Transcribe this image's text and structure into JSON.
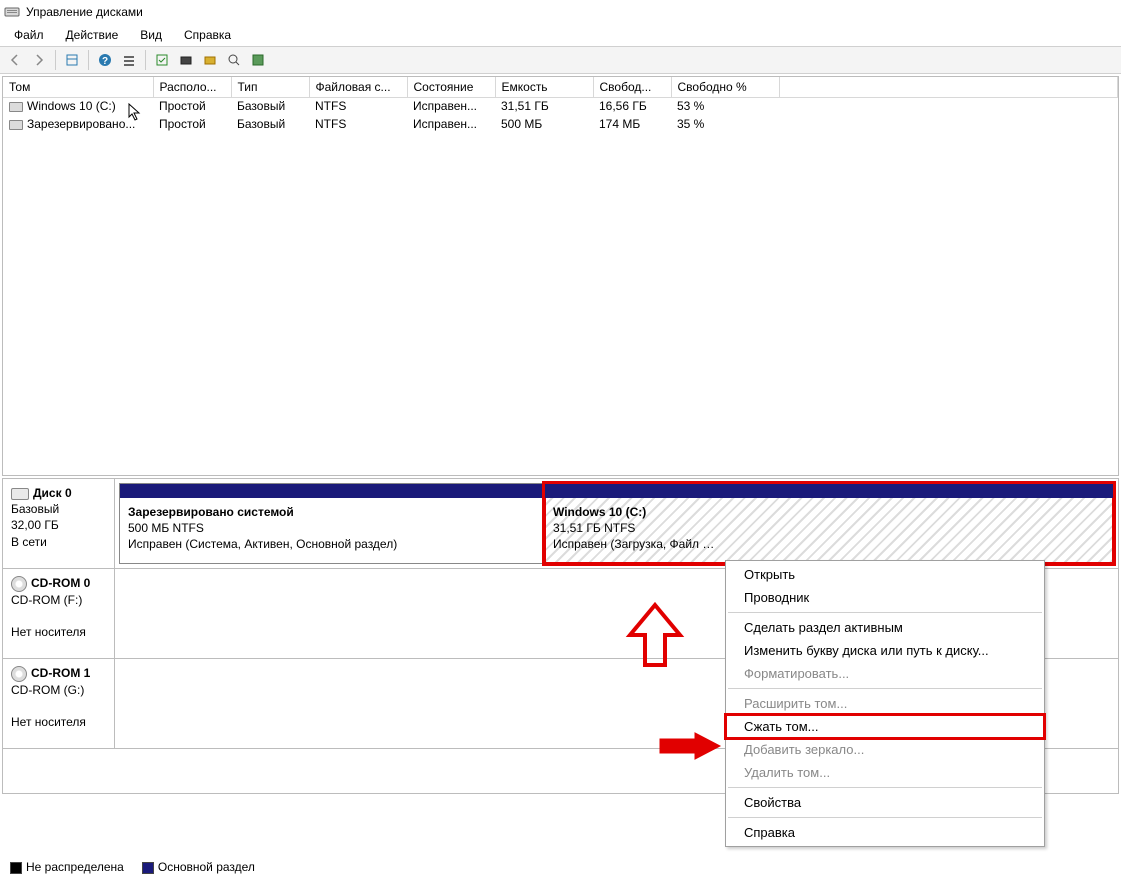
{
  "title": "Управление дисками",
  "menu": {
    "file": "Файл",
    "action": "Действие",
    "view": "Вид",
    "help": "Справка"
  },
  "columns": [
    "Том",
    "Располо...",
    "Тип",
    "Файловая с...",
    "Состояние",
    "Емкость",
    "Свобод...",
    "Свободно %"
  ],
  "rows": [
    {
      "vol": "Windows 10 (C:)",
      "layout": "Простой",
      "type": "Базовый",
      "fs": "NTFS",
      "status": "Исправен...",
      "cap": "31,51 ГБ",
      "free": "16,56 ГБ",
      "pct": "53 %"
    },
    {
      "vol": "Зарезервировано...",
      "layout": "Простой",
      "type": "Базовый",
      "fs": "NTFS",
      "status": "Исправен...",
      "cap": "500 МБ",
      "free": "174 МБ",
      "pct": "35 %"
    }
  ],
  "disks": {
    "d0": {
      "name": "Диск 0",
      "type": "Базовый",
      "size": "32,00 ГБ",
      "status": "В сети",
      "p1": {
        "title": "Зарезервировано системой",
        "sub": "500 МБ NTFS",
        "stat": "Исправен (Система, Активен, Основной раздел)"
      },
      "p2": {
        "title": "Windows 10  (C:)",
        "sub": "31,51 ГБ NTFS",
        "stat": "Исправен (Загрузка, Файл"
      }
    },
    "c0": {
      "name": "CD-ROM 0",
      "sub": "CD-ROM (F:)",
      "stat": "Нет носителя"
    },
    "c1": {
      "name": "CD-ROM 1",
      "sub": "CD-ROM (G:)",
      "stat": "Нет носителя"
    }
  },
  "ctx": {
    "open": "Открыть",
    "explorer": "Проводник",
    "active": "Сделать раздел активным",
    "change_letter": "Изменить букву диска или путь к диску...",
    "format": "Форматировать...",
    "extend": "Расширить том...",
    "shrink": "Сжать том...",
    "mirror": "Добавить зеркало...",
    "delete": "Удалить том...",
    "props": "Свойства",
    "help": "Справка"
  },
  "legend": {
    "unalloc": "Не распределена",
    "primary": "Основной раздел"
  }
}
